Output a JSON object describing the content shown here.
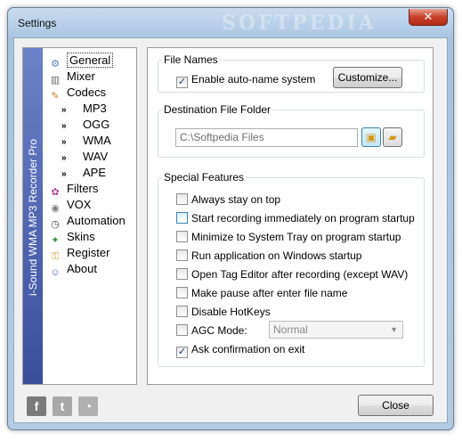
{
  "window": {
    "title": "Settings",
    "watermark": "SOFTPEDIA",
    "close_glyph": "✕"
  },
  "sidebar": {
    "banner_text": "i-Sound WMA MP3 Recorder Pro",
    "items": [
      {
        "label": "General",
        "icon": "gear-icon",
        "glyph": "⚙",
        "color": "#5b7fc4"
      },
      {
        "label": "Mixer",
        "icon": "mixer-icon",
        "glyph": "▥",
        "color": "#6b6b6b"
      },
      {
        "label": "Codecs",
        "icon": "codecs-icon",
        "glyph": "✎",
        "color": "#c9842c"
      },
      {
        "label": "MP3",
        "icon": "double-arrow-icon",
        "glyph": "»"
      },
      {
        "label": "OGG",
        "icon": "double-arrow-icon",
        "glyph": "»"
      },
      {
        "label": "WMA",
        "icon": "double-arrow-icon",
        "glyph": "»"
      },
      {
        "label": "WAV",
        "icon": "double-arrow-icon",
        "glyph": "»"
      },
      {
        "label": "APE",
        "icon": "double-arrow-icon",
        "glyph": "»"
      },
      {
        "label": "Filters",
        "icon": "filters-icon",
        "glyph": "✿",
        "color": "#b6408f"
      },
      {
        "label": "VOX",
        "icon": "vox-icon",
        "glyph": "◉",
        "color": "#7d7d7d"
      },
      {
        "label": "Automation",
        "icon": "clock-icon",
        "glyph": "◷",
        "color": "#4a4a4a"
      },
      {
        "label": "Skins",
        "icon": "skins-icon",
        "glyph": "✦",
        "color": "#3d8f3d"
      },
      {
        "label": "Register",
        "icon": "lock-icon",
        "glyph": "⚿",
        "color": "#c9a22c"
      },
      {
        "label": "About",
        "icon": "users-icon",
        "glyph": "☺",
        "color": "#4a6fb0"
      }
    ]
  },
  "file_names": {
    "legend": "File Names",
    "auto_name_label": "Enable auto-name system",
    "auto_name_checked": true,
    "customize_label": "Customize..."
  },
  "destination": {
    "legend": "Destination File Folder",
    "path_value": "C:\\Softpedia Files"
  },
  "special": {
    "legend": "Special  Features",
    "options": [
      {
        "label": "Always stay on top",
        "checked": false
      },
      {
        "label": "Start recording immediately on program startup",
        "checked": false
      },
      {
        "label": "Minimize to System Tray on program startup",
        "checked": false
      },
      {
        "label": "Run application on Windows startup",
        "checked": false
      },
      {
        "label": "Open Tag Editor after recording (except WAV)",
        "checked": false
      },
      {
        "label": "Make pause after enter file name",
        "checked": false
      },
      {
        "label": "Disable HotKeys",
        "checked": false
      },
      {
        "label": "AGC Mode:",
        "checked": false
      },
      {
        "label": "Ask confirmation on exit",
        "checked": true
      }
    ],
    "agc_value": "Normal"
  },
  "footer": {
    "close_label": "Close",
    "social": [
      {
        "icon": "facebook-icon",
        "glyph": "f",
        "color": "#7a7a7a"
      },
      {
        "icon": "twitter-icon",
        "glyph": "t",
        "color": "#a8a8a8"
      },
      {
        "icon": "rss-icon",
        "glyph": "◔",
        "color": "#b0b0b0"
      }
    ]
  }
}
